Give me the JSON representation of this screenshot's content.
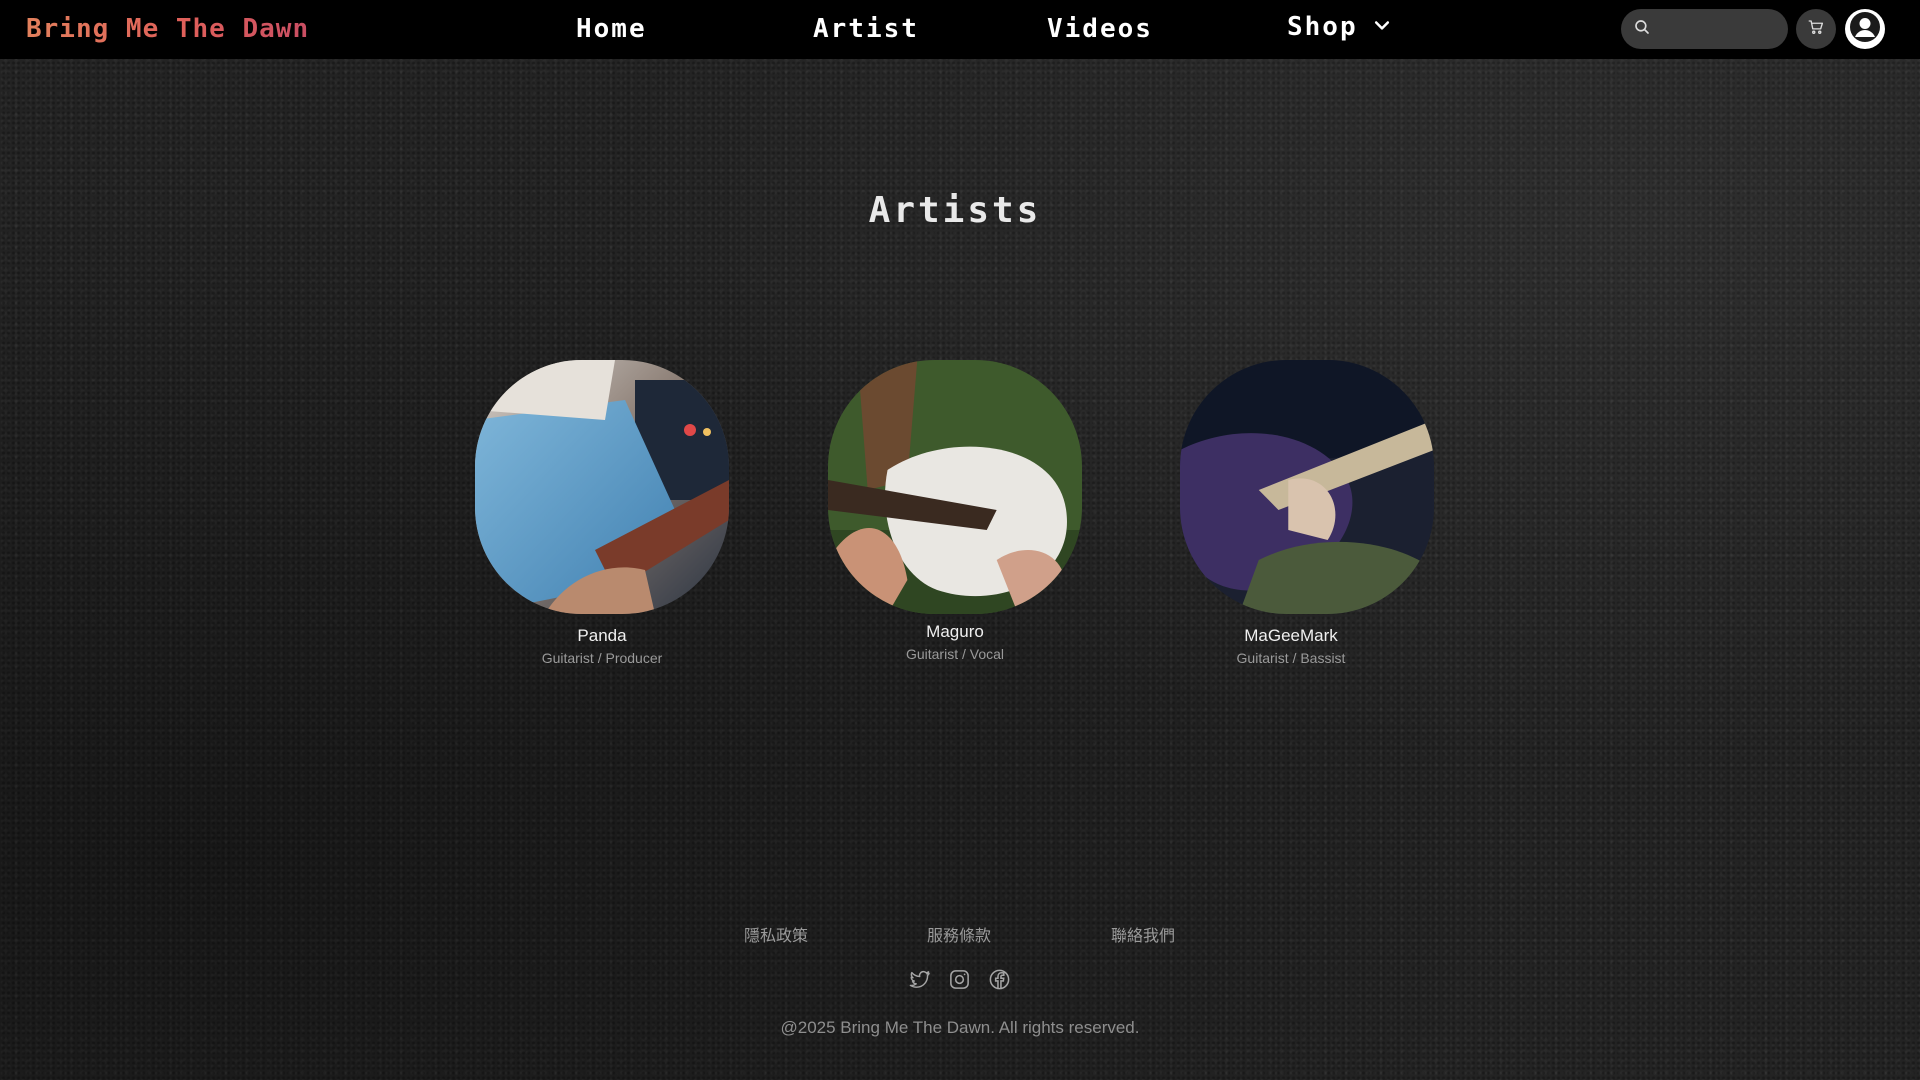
{
  "navbar": {
    "brand": "Bring Me The Dawn",
    "links": {
      "home": "Home",
      "artist": "Artist",
      "videos": "Videos",
      "shop": "Shop"
    },
    "search": {
      "placeholder": "",
      "value": ""
    },
    "icons": {
      "search": "search-icon",
      "cart": "cart-icon",
      "avatar": "user-avatar-icon",
      "shop_dropdown": "chevron-down-icon"
    }
  },
  "main": {
    "title": "Artists",
    "artists": [
      {
        "name": "Panda",
        "role": "Guitarist / Producer"
      },
      {
        "name": "Maguro",
        "role": "Guitarist / Vocal"
      },
      {
        "name": "MaGeeMark",
        "role": "Guitarist / Bassist"
      }
    ]
  },
  "footer": {
    "links": [
      "隱私政策",
      "服務條款",
      "聯絡我們"
    ],
    "social": [
      "twitter-icon",
      "instagram-icon",
      "facebook-icon"
    ],
    "copyright": "@2025 Bring Me The Dawn. All rights reserved."
  },
  "colors": {
    "brand_gradient_start": "#e2805c",
    "brand_gradient_end": "#c94e63",
    "navbar_bg": "#000000",
    "page_bg": "#232323"
  }
}
